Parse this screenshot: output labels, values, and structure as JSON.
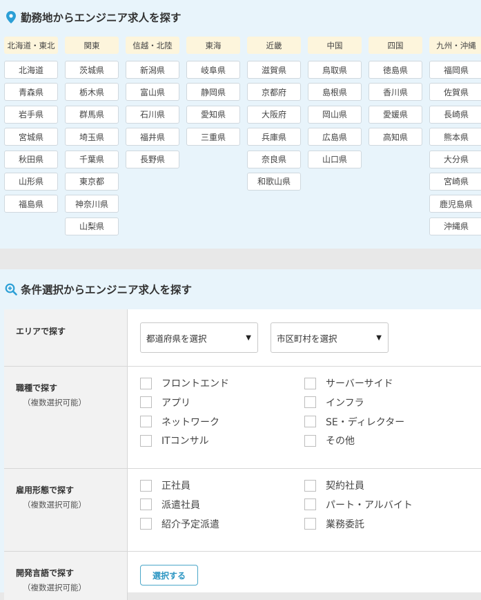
{
  "location_section": {
    "title": "勤務地からエンジニア求人を探す",
    "icon": "map-pin-icon",
    "icon_color": "#2b9fd6",
    "regions": [
      {
        "name": "北海道・東北",
        "prefectures": [
          "北海道",
          "青森県",
          "岩手県",
          "宮城県",
          "秋田県",
          "山形県",
          "福島県"
        ]
      },
      {
        "name": "関東",
        "prefectures": [
          "茨城県",
          "栃木県",
          "群馬県",
          "埼玉県",
          "千葉県",
          "東京都",
          "神奈川県",
          "山梨県"
        ]
      },
      {
        "name": "信越・北陸",
        "prefectures": [
          "新潟県",
          "富山県",
          "石川県",
          "福井県",
          "長野県"
        ]
      },
      {
        "name": "東海",
        "prefectures": [
          "岐阜県",
          "静岡県",
          "愛知県",
          "三重県"
        ]
      },
      {
        "name": "近畿",
        "prefectures": [
          "滋賀県",
          "京都府",
          "大阪府",
          "兵庫県",
          "奈良県",
          "和歌山県"
        ]
      },
      {
        "name": "中国",
        "prefectures": [
          "鳥取県",
          "島根県",
          "岡山県",
          "広島県",
          "山口県"
        ]
      },
      {
        "name": "四国",
        "prefectures": [
          "徳島県",
          "香川県",
          "愛媛県",
          "高知県"
        ]
      },
      {
        "name": "九州・沖縄",
        "prefectures": [
          "福岡県",
          "佐賀県",
          "長崎県",
          "熊本県",
          "大分県",
          "宮崎県",
          "鹿児島県",
          "沖縄県"
        ]
      }
    ]
  },
  "condition_section": {
    "title": "条件選択からエンジニア求人を探す",
    "icon": "search-plus-icon",
    "icon_color": "#2b9fd6",
    "area": {
      "label": "エリアで探す",
      "prefecture_select": "都道府県を選択",
      "city_select": "市区町村を選択"
    },
    "job_type": {
      "label": "職種で探す",
      "sub_label": "（複数選択可能）",
      "options": [
        "フロントエンド",
        "サーバーサイド",
        "アプリ",
        "インフラ",
        "ネットワーク",
        "SE・ディレクター",
        "ITコンサル",
        "その他"
      ]
    },
    "employment": {
      "label": "雇用形態で探す",
      "sub_label": "（複数選択可能）",
      "options": [
        "正社員",
        "契約社員",
        "派遣社員",
        "パート・アルバイト",
        "紹介予定派遣",
        "業務委託"
      ]
    },
    "language": {
      "label": "開発言語で探す",
      "sub_label": "（複数選択可能）",
      "button": "選択する"
    }
  },
  "colors": {
    "accent": "#2b9fd6",
    "section_bg": "#e8f4fb",
    "region_header_bg": "#fdf5dc"
  }
}
